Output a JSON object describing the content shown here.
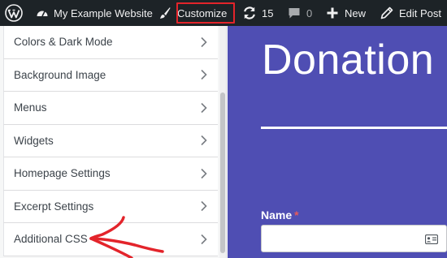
{
  "admin_bar": {
    "wp_logo_icon": "wordpress-logo-icon",
    "site_name": "My Example Website",
    "customize_label": "Customize",
    "updates_count": "15",
    "comments_count": "0",
    "new_label": "New",
    "edit_post_label": "Edit Post",
    "highlight_color": "#e3242b"
  },
  "customizer": {
    "items": [
      {
        "label": "Colors & Dark Mode"
      },
      {
        "label": "Background Image"
      },
      {
        "label": "Menus"
      },
      {
        "label": "Widgets"
      },
      {
        "label": "Homepage Settings"
      },
      {
        "label": "Excerpt Settings"
      },
      {
        "label": "Additional CSS"
      }
    ],
    "annotation_color": "#e3242b"
  },
  "preview": {
    "title": "Donation",
    "name_label": "Name",
    "required_marker": "*",
    "background_color": "#4f4eb3"
  }
}
